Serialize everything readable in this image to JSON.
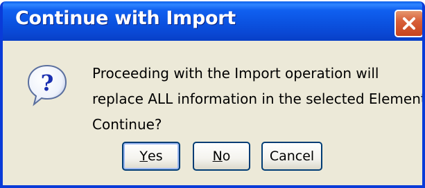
{
  "dialog": {
    "title": "Continue with Import",
    "message_lines": [
      "Proceeding with the Import operation will",
      "replace ALL information in the selected Elements.",
      "Continue?"
    ],
    "icon": "question-icon",
    "buttons": {
      "yes": {
        "mnemonic": "Y",
        "rest": "es"
      },
      "no": {
        "mnemonic": "N",
        "rest": "o"
      },
      "cancel": {
        "label": "Cancel"
      }
    },
    "default_button": "yes",
    "close_icon": "close-icon"
  },
  "colors": {
    "title_bar": "#0a52e0",
    "dialog_body": "#ece9d8",
    "close_button": "#d8603a",
    "button_border": "#003c74"
  }
}
